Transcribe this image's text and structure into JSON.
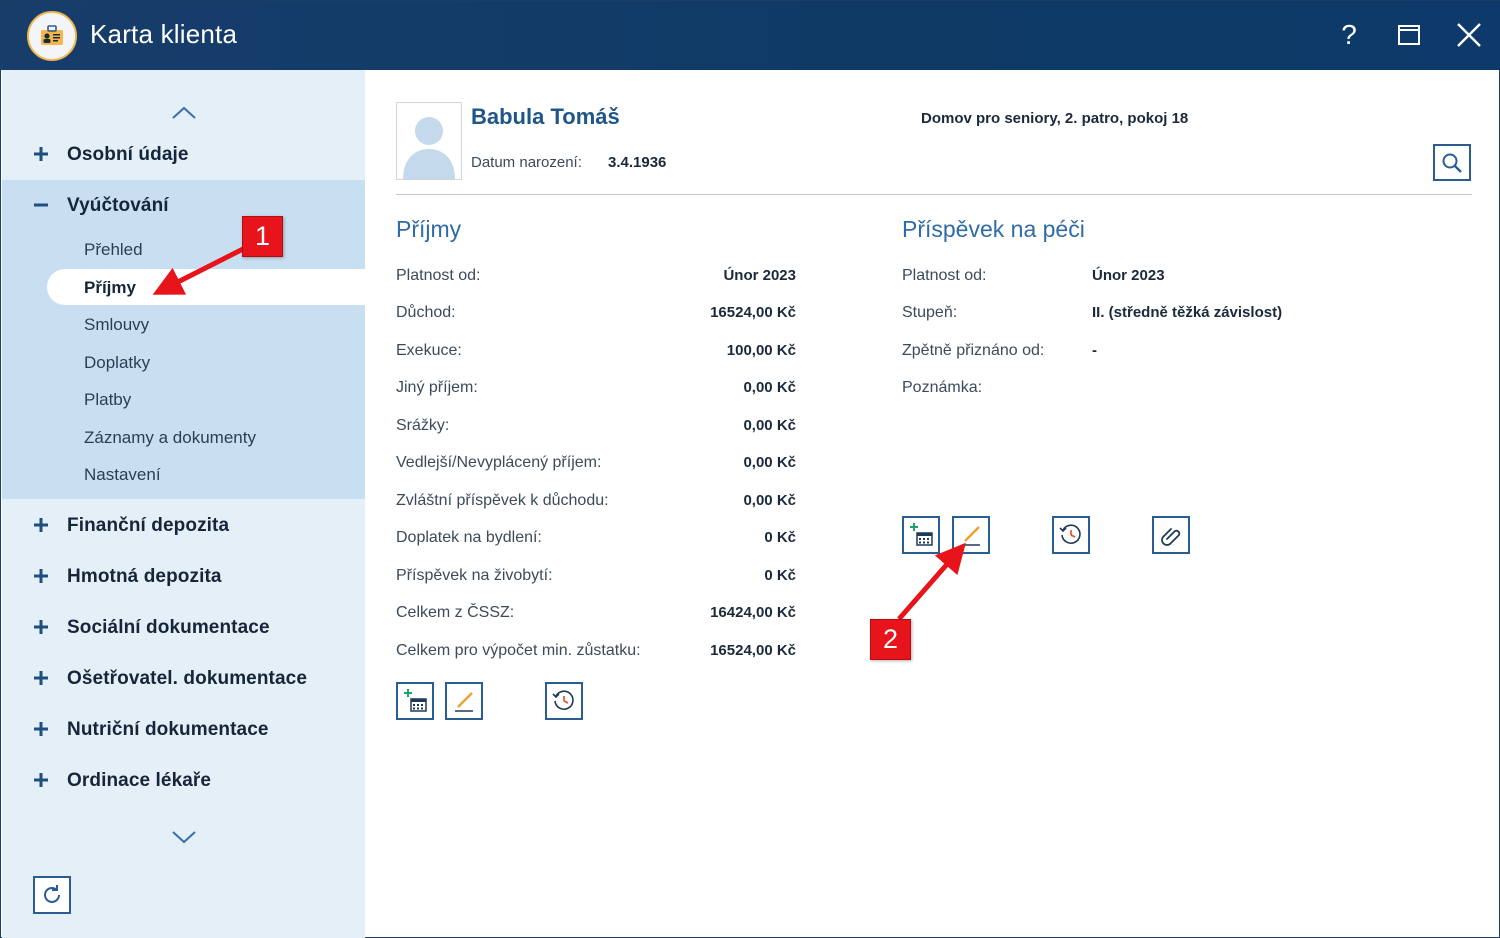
{
  "window": {
    "title": "Karta klienta",
    "help_label": "?"
  },
  "sidebar": {
    "sections": [
      {
        "label": "Osobní údaje"
      },
      {
        "label": "Vyúčtování"
      },
      {
        "label": "Finanční depozita"
      },
      {
        "label": "Hmotná depozita"
      },
      {
        "label": "Sociální dokumentace"
      },
      {
        "label": "Ošetřovatel. dokumentace"
      },
      {
        "label": "Nutriční dokumentace"
      },
      {
        "label": "Ordinace lékaře"
      }
    ],
    "subitems": [
      {
        "label": "Přehled"
      },
      {
        "label": "Příjmy",
        "active": true
      },
      {
        "label": "Smlouvy"
      },
      {
        "label": "Doplatky"
      },
      {
        "label": "Platby"
      },
      {
        "label": "Záznamy a dokumenty"
      },
      {
        "label": "Nastavení"
      }
    ]
  },
  "client": {
    "name": "Babula Tomáš",
    "birth_label": "Datum narození:",
    "birth_date": "3.4.1936",
    "address": "Domov pro seniory, 2. patro, pokoj 18"
  },
  "income": {
    "title": "Příjmy",
    "rows": [
      {
        "label": "Platnost od:",
        "value": "Únor 2023"
      },
      {
        "label": "Důchod:",
        "value": "16524,00 Kč"
      },
      {
        "label": "Exekuce:",
        "value": "100,00 Kč"
      },
      {
        "label": "Jiný příjem:",
        "value": "0,00 Kč"
      },
      {
        "label": "Srážky:",
        "value": "0,00 Kč"
      },
      {
        "label": "Vedlejší/Nevyplácený příjem:",
        "value": "0,00 Kč"
      },
      {
        "label": "Zvláštní příspěvek k důchodu:",
        "value": "0,00 Kč"
      },
      {
        "label": "Doplatek na bydlení:",
        "value": "0 Kč"
      },
      {
        "label": "Příspěvek na živobytí:",
        "value": "0 Kč"
      },
      {
        "label": "Celkem z ČSSZ:",
        "value": "16424,00 Kč"
      },
      {
        "label": "Celkem pro výpočet min. zůstatku:",
        "value": "16524,00 Kč"
      }
    ]
  },
  "care": {
    "title": "Příspěvek na péči",
    "rows": [
      {
        "label": "Platnost od:",
        "value": "Únor 2023"
      },
      {
        "label": "Stupeň:",
        "value": "II. (středně těžká závislost)"
      },
      {
        "label": "Zpětně přiznáno od:",
        "value": "-"
      },
      {
        "label": "Poznámka:",
        "value": ""
      }
    ]
  },
  "annotations": {
    "badge1": "1",
    "badge2": "2"
  },
  "colors": {
    "titlebar": "#173d6b",
    "accent": "#2f6ba6",
    "sidebar_bg": "#e5eff8",
    "sidebar_expanded": "#c8dff2",
    "annotation_red": "#e8141c"
  }
}
